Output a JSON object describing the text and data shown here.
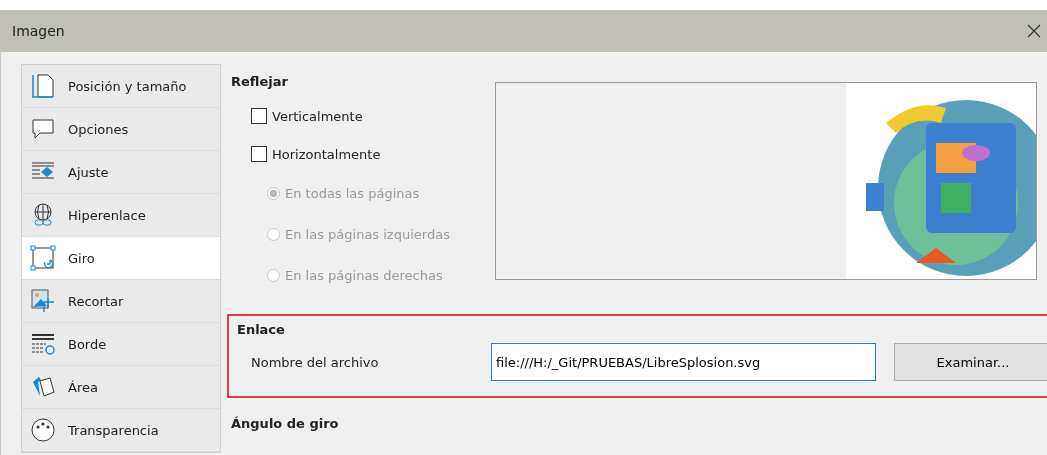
{
  "window": {
    "title": "Imagen"
  },
  "sidebar": {
    "items": [
      {
        "label": "Posición y tamaño",
        "selected": false
      },
      {
        "label": "Opciones",
        "selected": false
      },
      {
        "label": "Ajuste",
        "selected": false
      },
      {
        "label": "Hiperenlace",
        "selected": false
      },
      {
        "label": "Giro",
        "selected": true
      },
      {
        "label": "Recortar",
        "selected": false
      },
      {
        "label": "Borde",
        "selected": false
      },
      {
        "label": "Área",
        "selected": false
      },
      {
        "label": "Transparencia",
        "selected": false
      }
    ]
  },
  "mirror": {
    "heading": "Reflejar",
    "checkboxes": [
      {
        "label": "Verticalmente",
        "checked": false
      },
      {
        "label": "Horizontalmente",
        "checked": false
      }
    ],
    "radios": [
      {
        "label": "En todas las páginas",
        "selected": true,
        "disabled": true
      },
      {
        "label": "En las páginas izquierdas",
        "selected": false,
        "disabled": true
      },
      {
        "label": "En las páginas derechas",
        "selected": false,
        "disabled": true
      }
    ]
  },
  "link": {
    "heading": "Enlace",
    "highlighted": true,
    "file_label": "Nombre del archivo",
    "file_name": "file:///H:/_Git/PRUEBAS/LibreSplosion.svg",
    "browse_button": "Examinar..."
  },
  "rotation": {
    "heading": "Ángulo de giro"
  }
}
